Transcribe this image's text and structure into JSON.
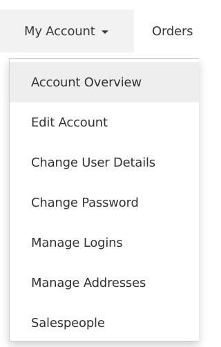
{
  "nav": {
    "account_label": "My Account",
    "orders_label": "Orders"
  },
  "menu": {
    "items": [
      {
        "label": "Account Overview",
        "active": true
      },
      {
        "label": "Edit Account",
        "active": false
      },
      {
        "label": "Change User Details",
        "active": false
      },
      {
        "label": "Change Password",
        "active": false
      },
      {
        "label": "Manage Logins",
        "active": false
      },
      {
        "label": "Manage Addresses",
        "active": false
      },
      {
        "label": "Salespeople",
        "active": false
      }
    ]
  },
  "colors": {
    "active_background": "#eeeeee",
    "nav_active_background": "#f2f2f2",
    "text": "#333333"
  }
}
